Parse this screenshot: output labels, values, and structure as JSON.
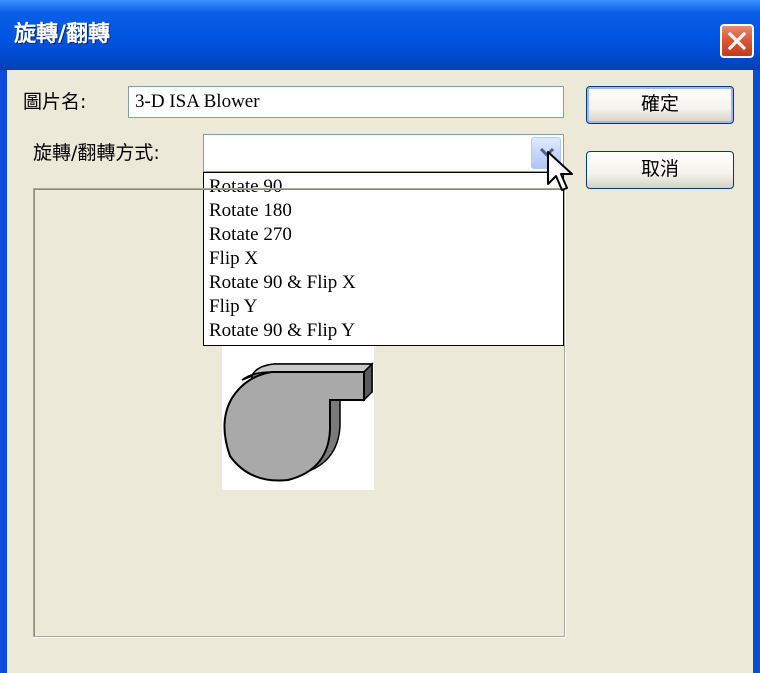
{
  "dialog": {
    "title": "旋轉/翻轉",
    "close_icon": "close-icon"
  },
  "form": {
    "name_label": "圖片名:",
    "name_value": "3-D ISA Blower",
    "mode_label": "旋轉/翻轉方式:",
    "mode_value": "",
    "mode_options": [
      "Rotate 90",
      "Rotate 180",
      "Rotate 270",
      "Flip X",
      "Rotate 90 & Flip X",
      "Flip Y",
      "Rotate 90 & Flip Y"
    ]
  },
  "buttons": {
    "ok_label": "確定",
    "cancel_label": "取消"
  },
  "preview": {
    "image_icon": "blower-icon"
  },
  "colors": {
    "titlebar": "#0054E3",
    "dialog_bg": "#ECE9D8",
    "close_button": "#D85A37"
  }
}
